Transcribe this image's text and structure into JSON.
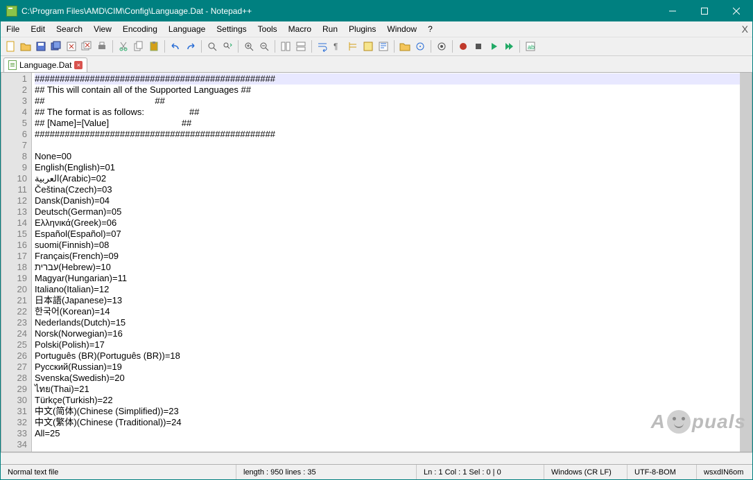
{
  "titlebar": {
    "title": "C:\\Program Files\\AMD\\CIM\\Config\\Language.Dat - Notepad++"
  },
  "menubar": {
    "items": [
      "File",
      "Edit",
      "Search",
      "View",
      "Encoding",
      "Language",
      "Settings",
      "Tools",
      "Macro",
      "Run",
      "Plugins",
      "Window",
      "?"
    ]
  },
  "toolbar_icons": [
    "new-file",
    "open-file",
    "save",
    "save-all",
    "close",
    "close-all",
    "print",
    "sep",
    "cut",
    "copy",
    "paste",
    "sep",
    "undo",
    "redo",
    "sep",
    "find",
    "replace",
    "sep",
    "zoom-in",
    "zoom-out",
    "sep",
    "sync-v",
    "sync-h",
    "sep",
    "wrap",
    "all-chars",
    "indent-guide",
    "lang-pref",
    "doc-map",
    "sep",
    "folder",
    "func-list",
    "sep",
    "monitor",
    "sep",
    "record",
    "stop",
    "play",
    "play-multi",
    "sep",
    "spell"
  ],
  "tab": {
    "label": "Language.Dat"
  },
  "code_lines": [
    "################################################",
    "## This will contain all of the Supported Languages ##",
    "##                                            ##",
    "## The format is as follows:                  ##",
    "## [Name]=[Value]                             ##",
    "################################################",
    "",
    "None=00",
    "English(English)=01",
    "العربية(Arabic)=02",
    "Čeština(Czech)=03",
    "Dansk(Danish)=04",
    "Deutsch(German)=05",
    "Ελληνικά(Greek)=06",
    "Español(Español)=07",
    "suomi(Finnish)=08",
    "Français(French)=09",
    "עברית(Hebrew)=10",
    "Magyar(Hungarian)=11",
    "Italiano(Italian)=12",
    "日本語(Japanese)=13",
    "한국어(Korean)=14",
    "Nederlands(Dutch)=15",
    "Norsk(Norwegian)=16",
    "Polski(Polish)=17",
    "Português (BR)(Português (BR))=18",
    "Русский(Russian)=19",
    "Svenska(Swedish)=20",
    "ไทย(Thai)=21",
    "Türkçe(Turkish)=22",
    "中文(简体)(Chinese (Simplified))=23",
    "中文(繁体)(Chinese (Traditional))=24",
    "All=25",
    "",
    ""
  ],
  "statusbar": {
    "file_type": "Normal text file",
    "length_label": "length : 950    lines : 35",
    "pos_label": "Ln : 1    Col : 1    Sel : 0 | 0",
    "eol": "Windows (CR LF)",
    "encoding": "UTF-8-BOM",
    "ins": "wsxdIN6om"
  },
  "watermark_text": "A   puals"
}
